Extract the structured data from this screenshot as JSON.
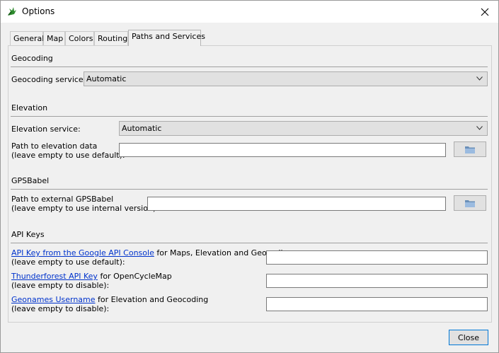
{
  "window": {
    "title": "Options"
  },
  "tabs": [
    {
      "label": "General"
    },
    {
      "label": "Map"
    },
    {
      "label": "Colors"
    },
    {
      "label": "Routing"
    },
    {
      "label": "Paths and Services"
    }
  ],
  "geocoding": {
    "heading": "Geocoding",
    "service_label": "Geocoding service:",
    "service_value": "Automatic"
  },
  "elevation": {
    "heading": "Elevation",
    "service_label": "Elevation service:",
    "service_value": "Automatic",
    "path_label_1": "Path to elevation data",
    "path_label_2": "(leave empty to use default):",
    "path_value": ""
  },
  "gpsbabel": {
    "heading": "GPSBabel",
    "path_label_1": "Path to external GPSBabel",
    "path_label_2": "(leave empty to use internal version):",
    "path_value": ""
  },
  "apikeys": {
    "heading": "API Keys",
    "google_link": "API Key from the Google API Console",
    "google_suffix": " for Maps, Elevation and Geocoding",
    "google_line2": "(leave empty to use default):",
    "thunder_link": "Thunderforest API Key",
    "thunder_suffix": " for OpenCycleMap",
    "thunder_line2": "(leave empty to disable):",
    "geonames_link": "Geonames Username",
    "geonames_suffix": " for Elevation and Geocoding",
    "geonames_line2": "(leave empty to disable):"
  },
  "footer": {
    "close_label": "Close"
  },
  "icons": {
    "folder": "folder-icon",
    "app": "app-icon"
  }
}
